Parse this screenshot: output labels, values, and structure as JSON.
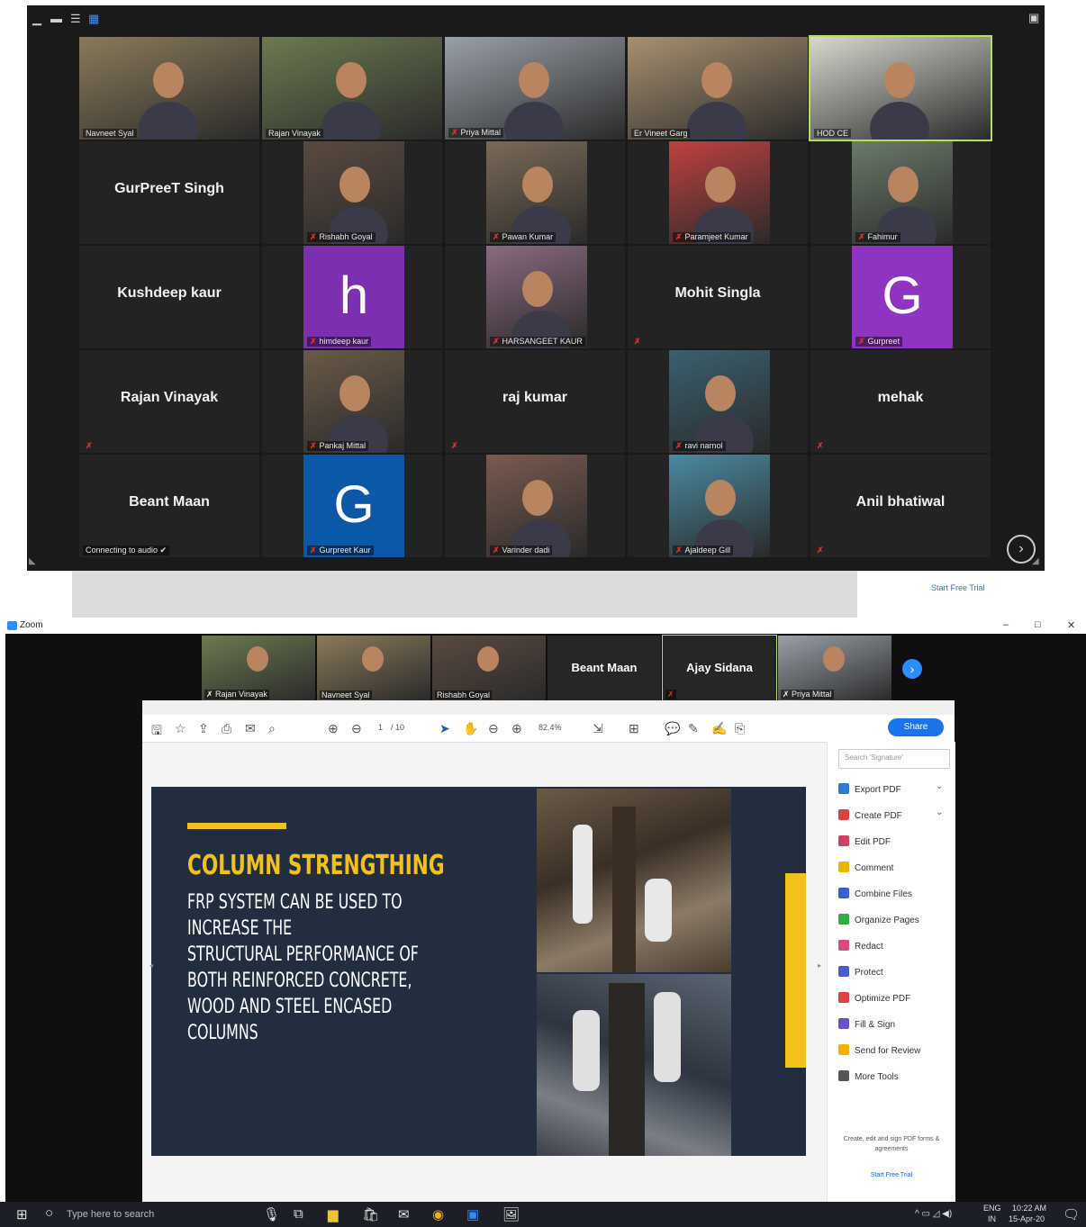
{
  "top_gallery": {
    "toolbar_icons": [
      "minimize-icon",
      "restore-icon",
      "speaker-view-icon",
      "gallery-view-icon",
      "exit-fullscreen-icon"
    ],
    "tiles": [
      {
        "name": "Navneet Syal",
        "video": true
      },
      {
        "name": "Rajan Vinayak",
        "video": true
      },
      {
        "name": "Priya Mittal",
        "video": true,
        "muted": true
      },
      {
        "name": "Er Vineet Garg",
        "video": true
      },
      {
        "name": "HOD CE",
        "video": true,
        "active": true
      },
      {
        "name": "GurPreeT Singh",
        "video": false
      },
      {
        "name": "Rishabh Goyal",
        "video": true,
        "muted": true
      },
      {
        "name": "Pawan Kumar",
        "video": true,
        "muted": true
      },
      {
        "name": "Paramjeet Kumar",
        "video": true,
        "muted": true
      },
      {
        "name": "Fahimur",
        "video": true,
        "muted": true
      },
      {
        "name": "Kushdeep kaur",
        "video": false
      },
      {
        "name": "himdeep kaur",
        "avatar": "h",
        "avatar_color": "#7d2fb2",
        "muted": true
      },
      {
        "name": "HARSANGEET KAUR",
        "video": true,
        "muted": true
      },
      {
        "name": "Mohit Singla",
        "video": false,
        "muted": true
      },
      {
        "name": "Gurpreet",
        "avatar": "G",
        "avatar_color": "#9033c0",
        "muted": true
      },
      {
        "name": "Rajan Vinayak",
        "video": false,
        "muted": true
      },
      {
        "name": "Pankaj Mittal",
        "video": true,
        "muted": true
      },
      {
        "name": "raj kumar",
        "video": false,
        "muted": true
      },
      {
        "name": "ravi narnol",
        "video": true,
        "muted": true
      },
      {
        "name": "mehak",
        "video": false,
        "muted": true
      },
      {
        "name": "Beant Maan",
        "video": false,
        "status": "Connecting to audio ✔"
      },
      {
        "name": "Gurpreet Kaur",
        "avatar": "G",
        "avatar_color": "#0b57a8",
        "muted": true
      },
      {
        "name": "Varinder dadi",
        "video": true,
        "muted": true
      },
      {
        "name": "Ajaldeep Gill",
        "video": true,
        "muted": true
      },
      {
        "name": "Anil bhatiwal",
        "video": false,
        "muted": true
      }
    ],
    "next_page_icon": "chevron-right-icon",
    "behind_text": "Start Free Trial"
  },
  "zoom_window": {
    "title": "Zoom",
    "controls": [
      "–",
      "□",
      "✕"
    ],
    "participants": [
      {
        "name": "Rajan Vinayak",
        "video": true,
        "muted": true
      },
      {
        "name": "Navneet Syal",
        "video": true
      },
      {
        "name": "Rishabh Goyal",
        "video": true
      },
      {
        "name": "Beant Maan",
        "video": false
      },
      {
        "name": "Ajay Sidana",
        "video": false,
        "muted": true,
        "active": true
      },
      {
        "name": "Priya Mittal",
        "video": true,
        "muted": true
      }
    ]
  },
  "acrobat": {
    "share_label": "Share",
    "page_input": "1",
    "page_total": "/ 10",
    "zoom_level": "82.4%",
    "search_placeholder": "Search 'Signature'",
    "tools": [
      {
        "label": "Export PDF",
        "color": "#2d7bd6",
        "expand": true
      },
      {
        "label": "Create PDF",
        "color": "#e04040",
        "expand": true
      },
      {
        "label": "Edit PDF",
        "color": "#d04060"
      },
      {
        "label": "Comment",
        "color": "#f0b400"
      },
      {
        "label": "Combine Files",
        "color": "#3a5fcf"
      },
      {
        "label": "Organize Pages",
        "color": "#35a84a"
      },
      {
        "label": "Redact",
        "color": "#d94a7a"
      },
      {
        "label": "Protect",
        "color": "#4b5bd0"
      },
      {
        "label": "Optimize PDF",
        "color": "#e04040"
      },
      {
        "label": "Fill & Sign",
        "color": "#6a4fd0"
      },
      {
        "label": "Send for Review",
        "color": "#f0b400"
      },
      {
        "label": "More Tools",
        "color": "#555555"
      }
    ],
    "panel_note": "Create, edit and sign PDF forms & agreements",
    "panel_link": "Start Free Trial",
    "slide": {
      "title": "COLUMN STRENGTHING",
      "body": [
        "FRP SYSTEM CAN BE USED TO",
        "INCREASE THE",
        "STRUCTURAL PERFORMANCE OF",
        "BOTH REINFORCED CONCRETE,",
        "WOOD AND STEEL ENCASED",
        "COLUMNS"
      ],
      "accent": "#f2c21b"
    }
  },
  "taskbar": {
    "search_placeholder": "Type here to search",
    "lang": "ENG",
    "region": "IN",
    "time": "10:22 AM",
    "date": "15-Apr-20"
  }
}
